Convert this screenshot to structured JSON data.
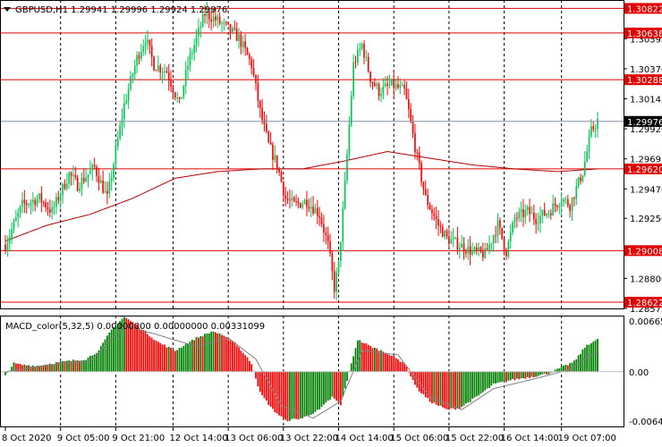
{
  "header": {
    "symbol": "GBPUSD,H1",
    "ohlc": "1.29941 1.29996 1.29924 1.29976"
  },
  "macd_header": "MACD_color(5,32,5) 0.00000000 0.00000000 0.00331099",
  "colors": {
    "bull": "#00c853",
    "bear": "#ff0000",
    "level_line": "#e00000",
    "ma": "#b00000",
    "macd_up": "#008000",
    "macd_down": "#ff0000",
    "signal": "#808080",
    "grid": "#000000",
    "price_tag": "#e00000",
    "current_tag": "#000000"
  },
  "chart_data": [
    {
      "type": "candlestick",
      "title": "GBPUSD,H1",
      "ylim": [
        1.28575,
        1.30885
      ],
      "horizontal_levels": [
        1.30822,
        1.30638,
        1.30288,
        1.2962,
        1.29008,
        1.28622
      ],
      "current_price": 1.29976,
      "y_tick_labels": [
        "1.30595",
        "1.30370",
        "1.30145",
        "1.29920",
        "1.29695",
        "1.29470",
        "1.29250",
        "1.29025",
        "1.28800",
        "1.28575"
      ],
      "x_tick_labels": [
        "8 Oct 2020",
        "9 Oct 05:00",
        "9 Oct 21:00",
        "12 Oct 14:00",
        "13 Oct 06:00",
        "13 Oct 22:00",
        "14 Oct 14:00",
        "15 Oct 06:00",
        "15 Oct 22:00",
        "16 Oct 14:00",
        "19 Oct 07:00"
      ],
      "close_path": [
        [
          0,
          1.2905
        ],
        [
          8,
          1.2935
        ],
        [
          16,
          1.294
        ],
        [
          22,
          1.293
        ],
        [
          30,
          1.2958
        ],
        [
          34,
          1.295
        ],
        [
          42,
          1.2963
        ],
        [
          48,
          1.294
        ],
        [
          52,
          1.2975
        ],
        [
          56,
          1.301
        ],
        [
          62,
          1.3045
        ],
        [
          66,
          1.306
        ],
        [
          70,
          1.304
        ],
        [
          76,
          1.3035
        ],
        [
          82,
          1.301
        ],
        [
          86,
          1.304
        ],
        [
          90,
          1.306
        ],
        [
          94,
          1.3078
        ],
        [
          98,
          1.3075
        ],
        [
          104,
          1.3068
        ],
        [
          110,
          1.306
        ],
        [
          116,
          1.304
        ],
        [
          120,
          1.3005
        ],
        [
          124,
          1.298
        ],
        [
          128,
          1.2965
        ],
        [
          132,
          1.294
        ],
        [
          136,
          1.2935
        ],
        [
          142,
          1.2938
        ],
        [
          148,
          1.2928
        ],
        [
          152,
          1.2905
        ],
        [
          155,
          1.2873
        ],
        [
          157,
          1.289
        ],
        [
          160,
          1.295
        ],
        [
          164,
          1.304
        ],
        [
          168,
          1.3055
        ],
        [
          172,
          1.303
        ],
        [
          176,
          1.302
        ],
        [
          182,
          1.3025
        ],
        [
          188,
          1.302
        ],
        [
          190,
          1.3005
        ],
        [
          194,
          1.297
        ],
        [
          198,
          1.294
        ],
        [
          204,
          1.292
        ],
        [
          208,
          1.291
        ],
        [
          214,
          1.2905
        ],
        [
          220,
          1.29
        ],
        [
          226,
          1.2898
        ],
        [
          232,
          1.292
        ],
        [
          236,
          1.29
        ],
        [
          240,
          1.2925
        ],
        [
          246,
          1.293
        ],
        [
          250,
          1.2925
        ],
        [
          256,
          1.293
        ],
        [
          262,
          1.294
        ],
        [
          266,
          1.2935
        ],
        [
          272,
          1.296
        ],
        [
          276,
          1.299
        ],
        [
          279,
          1.2998
        ]
      ],
      "moving_average": [
        [
          0,
          1.2908
        ],
        [
          20,
          1.292
        ],
        [
          40,
          1.2928
        ],
        [
          60,
          1.294
        ],
        [
          80,
          1.2955
        ],
        [
          100,
          1.296
        ],
        [
          120,
          1.2962
        ],
        [
          140,
          1.2962
        ],
        [
          160,
          1.2968
        ],
        [
          180,
          1.2975
        ],
        [
          200,
          1.297
        ],
        [
          220,
          1.2965
        ],
        [
          240,
          1.2962
        ],
        [
          260,
          1.296
        ],
        [
          279,
          1.2962
        ]
      ]
    },
    {
      "type": "bar",
      "title": "MACD_color(5,32,5)",
      "ylim": [
        -0.006482,
        0.006651
      ],
      "y_tick_labels": [
        "0.0066512",
        "0.00",
        "-0.006482"
      ],
      "histogram_path": [
        [
          0,
          -0.0005
        ],
        [
          4,
          0.001
        ],
        [
          8,
          0.0008
        ],
        [
          16,
          0.0007
        ],
        [
          22,
          0.001
        ],
        [
          28,
          0.0012
        ],
        [
          38,
          0.0015
        ],
        [
          44,
          0.0025
        ],
        [
          50,
          0.005
        ],
        [
          56,
          0.0065
        ],
        [
          62,
          0.0055
        ],
        [
          72,
          0.0035
        ],
        [
          80,
          0.0025
        ],
        [
          90,
          0.004
        ],
        [
          98,
          0.0048
        ],
        [
          108,
          0.0035
        ],
        [
          116,
          0.001
        ],
        [
          120,
          -0.0025
        ],
        [
          126,
          -0.0045
        ],
        [
          132,
          -0.0058
        ],
        [
          140,
          -0.0055
        ],
        [
          148,
          -0.0045
        ],
        [
          154,
          -0.003
        ],
        [
          158,
          -0.004
        ],
        [
          162,
          0.0
        ],
        [
          166,
          0.0038
        ],
        [
          172,
          0.003
        ],
        [
          180,
          0.0022
        ],
        [
          188,
          0.001
        ],
        [
          194,
          -0.002
        ],
        [
          200,
          -0.0035
        ],
        [
          208,
          -0.0045
        ],
        [
          214,
          -0.0043
        ],
        [
          222,
          -0.003
        ],
        [
          230,
          -0.0015
        ],
        [
          238,
          -0.001
        ],
        [
          248,
          -0.0006
        ],
        [
          256,
          -0.0002
        ],
        [
          262,
          0.0005
        ],
        [
          268,
          0.0012
        ],
        [
          274,
          0.0032
        ],
        [
          279,
          0.0038
        ]
      ],
      "signal_path": [
        [
          0,
          0.0
        ],
        [
          20,
          0.0008
        ],
        [
          40,
          0.0012
        ],
        [
          56,
          0.0055
        ],
        [
          70,
          0.0045
        ],
        [
          90,
          0.003
        ],
        [
          105,
          0.004
        ],
        [
          118,
          0.0015
        ],
        [
          130,
          -0.004
        ],
        [
          145,
          -0.0055
        ],
        [
          158,
          -0.0035
        ],
        [
          168,
          0.0025
        ],
        [
          185,
          0.002
        ],
        [
          200,
          -0.003
        ],
        [
          215,
          -0.0045
        ],
        [
          230,
          -0.002
        ],
        [
          250,
          -0.0008
        ],
        [
          265,
          0.0002
        ],
        [
          279,
          0.0025
        ]
      ]
    }
  ]
}
